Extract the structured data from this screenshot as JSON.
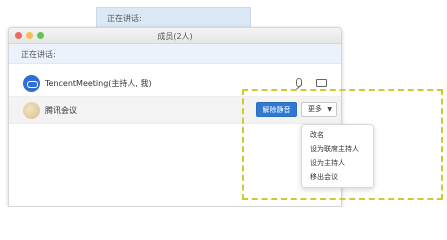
{
  "background_tab": {
    "label": "正在讲话:"
  },
  "window": {
    "title": "成员(2人)",
    "speaking_label": "正在讲话:"
  },
  "participants": [
    {
      "name": "TencentMeeting(主持人, 我)"
    },
    {
      "name": "腾讯会议",
      "primary_action": "解除静音",
      "more_label": "更多"
    }
  ],
  "more_menu": {
    "items": [
      "改名",
      "设为联席主持人",
      "设为主持人",
      "移出会议"
    ]
  },
  "colors": {
    "primary_button": "#2f79d3",
    "highlight_border": "#cfc934",
    "speaking_bar": "#ecf2fb"
  }
}
